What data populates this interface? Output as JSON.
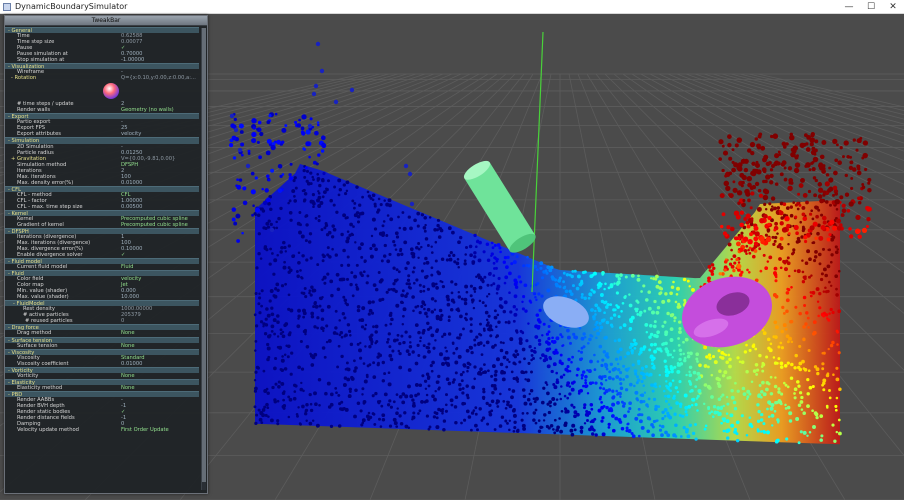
{
  "window": {
    "title": "DynamicBoundarySimulator",
    "min_glyph": "—",
    "max_glyph": "☐",
    "close_glyph": "✕"
  },
  "tweakbar": {
    "title": "TweakBar",
    "rows": [
      {
        "type": "group",
        "label": "- General"
      },
      {
        "type": "item",
        "label": "Time",
        "value": "0.62588",
        "vclass": "ro"
      },
      {
        "type": "item",
        "label": "Time step size",
        "value": "0.00077",
        "vclass": "ro"
      },
      {
        "type": "item",
        "label": "Pause",
        "value": "✓",
        "vclass": "edit"
      },
      {
        "type": "item",
        "label": "Pause simulation at",
        "value": "0.70000",
        "vclass": ""
      },
      {
        "type": "item",
        "label": "Stop simulation at",
        "value": "-1.00000",
        "vclass": ""
      },
      {
        "type": "group",
        "label": "- Visualization"
      },
      {
        "type": "item",
        "label": "Wireframe",
        "value": "-",
        "vclass": ""
      },
      {
        "type": "item",
        "label": "- Rotation",
        "value": "Q={x:0.10,y:0.00,z:0.00,a:...",
        "vclass": "ro",
        "lclass": "yellow",
        "llabelleft": true
      },
      {
        "type": "rotwidget"
      },
      {
        "type": "item",
        "label": "# time steps / update",
        "value": "2",
        "vclass": ""
      },
      {
        "type": "item",
        "label": "Render walls",
        "value": "Geometry (no walls)",
        "vclass": "edit"
      },
      {
        "type": "group",
        "label": "- Export"
      },
      {
        "type": "item",
        "label": "Partio export",
        "value": "-",
        "vclass": ""
      },
      {
        "type": "item",
        "label": "Export FPS",
        "value": "25",
        "vclass": ""
      },
      {
        "type": "item",
        "label": "Export attributes",
        "value": "velocity",
        "vclass": ""
      },
      {
        "type": "group",
        "label": "- Simulation"
      },
      {
        "type": "item",
        "label": "2D Simulation",
        "value": "-",
        "vclass": ""
      },
      {
        "type": "item",
        "label": "Particle radius",
        "value": "0.01250",
        "vclass": ""
      },
      {
        "type": "item",
        "label": "+ Gravitation",
        "value": "V={0.00,-9.81,0.00}",
        "vclass": "ro",
        "lclass": "yellow",
        "llabelleft": true
      },
      {
        "type": "item",
        "label": "Simulation method",
        "value": "DFSPH",
        "vclass": "edit"
      },
      {
        "type": "item",
        "label": "Iterations",
        "value": "2",
        "vclass": ""
      },
      {
        "type": "item",
        "label": "Max. iterations",
        "value": "100",
        "vclass": ""
      },
      {
        "type": "item",
        "label": "Max. density error(%)",
        "value": "0.01000",
        "vclass": ""
      },
      {
        "type": "group",
        "label": "- CFL"
      },
      {
        "type": "item",
        "label": "CFL - method",
        "value": "CFL",
        "vclass": "edit"
      },
      {
        "type": "item",
        "label": "CFL - factor",
        "value": "1.00000",
        "vclass": ""
      },
      {
        "type": "item",
        "label": "CFL - max. time step size",
        "value": "0.00500",
        "vclass": ""
      },
      {
        "type": "group",
        "label": "- Kernel"
      },
      {
        "type": "item",
        "label": "Kernel",
        "value": "Precomputed cubic spline",
        "vclass": "edit"
      },
      {
        "type": "item",
        "label": "Gradient of kernel",
        "value": "Precomputed cubic spline",
        "vclass": "edit"
      },
      {
        "type": "group",
        "label": "- DFSPH"
      },
      {
        "type": "item",
        "label": "Iterations (divergence)",
        "value": "1",
        "vclass": ""
      },
      {
        "type": "item",
        "label": "Max. iterations (divergence)",
        "value": "100",
        "vclass": ""
      },
      {
        "type": "item",
        "label": "Max. divergence error(%)",
        "value": "0.10000",
        "vclass": ""
      },
      {
        "type": "item",
        "label": "Enable divergence solver",
        "value": "✓",
        "vclass": "edit"
      },
      {
        "type": "group",
        "label": "- Fluid model"
      },
      {
        "type": "item",
        "label": "Current fluid model",
        "value": "Fluid",
        "vclass": "edit"
      },
      {
        "type": "group",
        "label": "- Fluid"
      },
      {
        "type": "item",
        "label": "Color field",
        "value": "velocity",
        "vclass": "edit"
      },
      {
        "type": "item",
        "label": "Color map",
        "value": "Jet",
        "vclass": "edit"
      },
      {
        "type": "item",
        "label": "Min. value (shader)",
        "value": "0.000",
        "vclass": ""
      },
      {
        "type": "item",
        "label": "Max. value (shader)",
        "value": "10.000",
        "vclass": ""
      },
      {
        "type": "group",
        "label": "- FluidModel",
        "indent": true
      },
      {
        "type": "item",
        "label": "Rest density",
        "value": "1000.00000",
        "vclass": "ro",
        "sub": "sub"
      },
      {
        "type": "item",
        "label": "# active particles",
        "value": "205379",
        "vclass": "ro",
        "sub": "sub"
      },
      {
        "type": "item",
        "label": "# reused particles",
        "value": "0",
        "vclass": "ro",
        "sub": "sub2"
      },
      {
        "type": "group",
        "label": "- Drag force"
      },
      {
        "type": "item",
        "label": "Drag method",
        "value": "None",
        "vclass": "edit"
      },
      {
        "type": "group",
        "label": "- Surface tension"
      },
      {
        "type": "item",
        "label": "Surface tension",
        "value": "None",
        "vclass": "edit"
      },
      {
        "type": "group",
        "label": "- Viscosity"
      },
      {
        "type": "item",
        "label": "Viscosity",
        "value": "Standard",
        "vclass": "edit"
      },
      {
        "type": "item",
        "label": "Viscosity coefficient",
        "value": "0.01000",
        "vclass": ""
      },
      {
        "type": "group",
        "label": "- Vorticity"
      },
      {
        "type": "item",
        "label": "Vorticity",
        "value": "None",
        "vclass": "edit"
      },
      {
        "type": "group",
        "label": "- Elasticity"
      },
      {
        "type": "item",
        "label": "Elasticity method",
        "value": "None",
        "vclass": "edit"
      },
      {
        "type": "group",
        "label": "- PBD"
      },
      {
        "type": "item",
        "label": "Render AABBs",
        "value": "-",
        "vclass": ""
      },
      {
        "type": "item",
        "label": "Render BVH depth",
        "value": "-1",
        "vclass": ""
      },
      {
        "type": "item",
        "label": "Render static bodies",
        "value": "✓",
        "vclass": "edit"
      },
      {
        "type": "item",
        "label": "Render distance fields",
        "value": "-1",
        "vclass": ""
      },
      {
        "type": "item",
        "label": "Damping",
        "value": "0",
        "vclass": ""
      },
      {
        "type": "item",
        "label": "Velocity update method",
        "value": "First Order Update",
        "vclass": "edit"
      }
    ]
  },
  "colors": {
    "viewport_bg": "#4b4b4b",
    "grid": "#5c5c5c",
    "cylinder": "#6fe39a",
    "torus": "#c44ddc",
    "ellipsoid": "#8aaef5",
    "axis_line": "#49d23a"
  },
  "colormap": {
    "name": "Jet",
    "min": 0.0,
    "max": 10.0
  }
}
